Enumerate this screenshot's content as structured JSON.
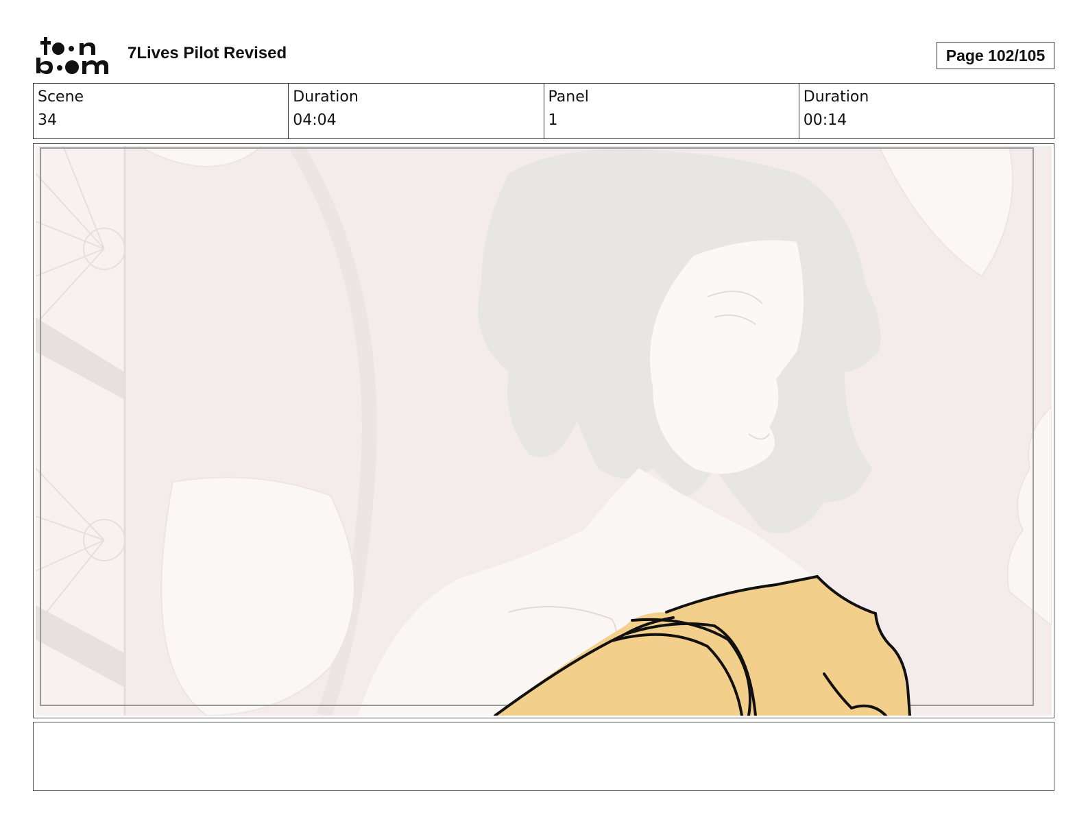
{
  "header": {
    "logo_name": "toon-boom-logo",
    "title": "7Lives Pilot Revised",
    "page": "Page 102/105"
  },
  "info": {
    "scene_label": "Scene",
    "scene_value": "34",
    "scene_duration_label": "Duration",
    "scene_duration_value": "04:04",
    "panel_label": "Panel",
    "panel_value": "1",
    "panel_duration_label": "Duration",
    "panel_duration_value": "00:14"
  },
  "panel": {
    "background_color": "#f4ecec",
    "accent_color": "#f2cf8a",
    "line_color": "#111111"
  },
  "notes": {
    "text": ""
  }
}
